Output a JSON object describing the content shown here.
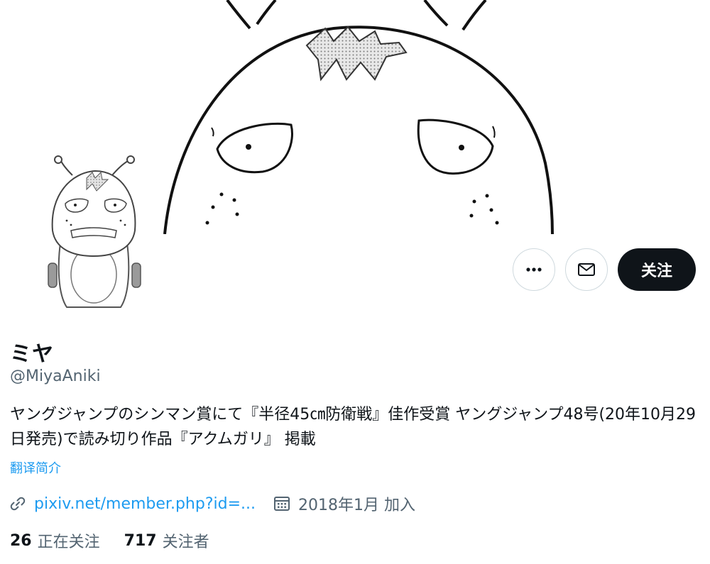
{
  "profile": {
    "display_name": "ミヤ",
    "handle": "@MiyaAniki",
    "bio": "ヤングジャンプのシンマン賞にて『半径45㎝防衛戦』佳作受賞 ヤングジャンプ48号(20年10月29日発売)で読み切り作品『アクムガリ』 掲載",
    "translate_label": "翻译简介",
    "website": "pixiv.net/member.php?id=...",
    "joined": "2018年1月 加入"
  },
  "actions": {
    "more_icon": "more-horizontal-icon",
    "message_icon": "envelope-icon",
    "follow_label": "关注"
  },
  "stats": {
    "following_count": "26",
    "following_label": "正在关注",
    "followers_count": "717",
    "followers_label": "关注者"
  },
  "colors": {
    "accent": "#1d9bf0",
    "follow_button_bg": "#0f1419",
    "secondary_text": "#536471",
    "border": "#cfd9de"
  }
}
